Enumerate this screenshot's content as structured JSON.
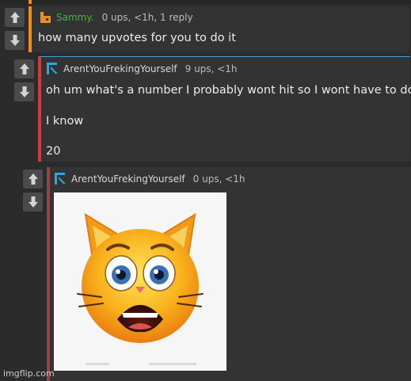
{
  "thread": {
    "comment1": {
      "username": "Sammy.",
      "stats": "0 ups, <1h, 1 reply",
      "text": "how many upvotes for you to do it",
      "accent_color": "#f28c1b",
      "username_color": "#3db83d",
      "avatar_icon": "user-icon-orange"
    },
    "comment2": {
      "username": "ArentYouFrekingYourself",
      "stats": "9 ups, <1h",
      "lines": [
        "oh um what's a number I probably wont hit so I wont have to do it",
        "I know",
        "20"
      ],
      "accent_color": "#d9373a",
      "username_color": "#d8d8d8",
      "avatar_icon": "user-icon-blue"
    },
    "comment3": {
      "username": "ArentYouFrekingYourself",
      "stats": "0 ups, <1h",
      "image_description_icon": "scared-cat-emoji",
      "accent_color": "#8a4848",
      "username_color": "#d8d8d8",
      "avatar_icon": "user-icon-blue"
    }
  },
  "footer": {
    "watermark": "imgflip.com"
  }
}
